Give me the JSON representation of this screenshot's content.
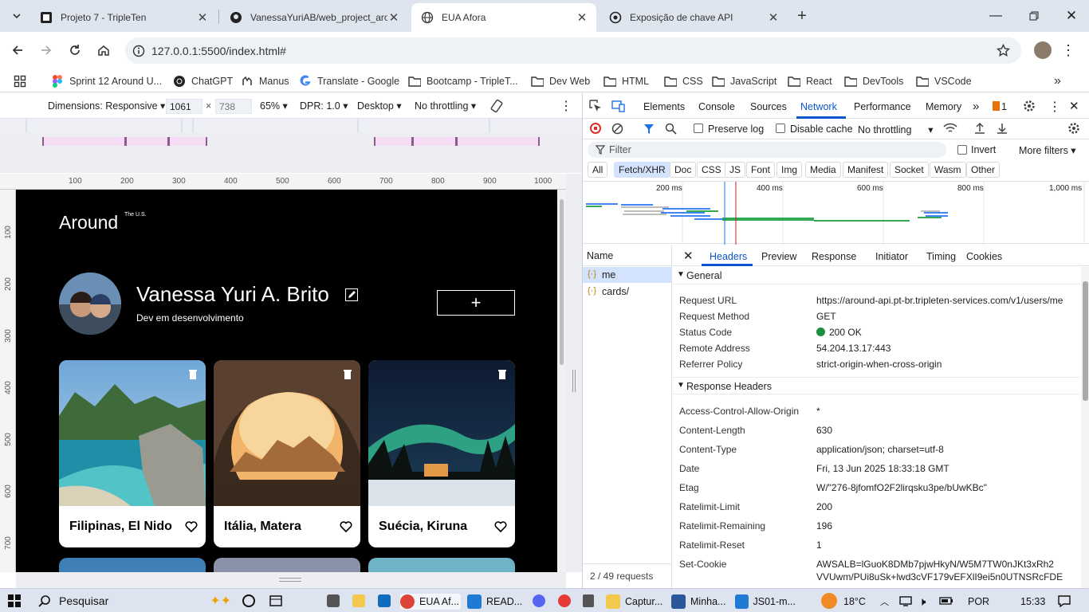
{
  "tabs": [
    {
      "title": "Projeto 7 - TripleTen",
      "icon": "tripleten-icon"
    },
    {
      "title": "VanessaYuriAB/web_project_aro",
      "icon": "github-icon"
    },
    {
      "title": "EUA Afora",
      "icon": "globe-icon",
      "active": true
    },
    {
      "title": "Exposição de chave API",
      "icon": "openai-icon"
    }
  ],
  "omnibox": {
    "url": "127.0.0.1:5500/index.html#"
  },
  "bookmarks": [
    {
      "label": "Sprint 12 Around U...",
      "icon": "figma-icon"
    },
    {
      "label": "ChatGPT",
      "icon": "openai-icon"
    },
    {
      "label": "Manus",
      "icon": "manus-icon"
    },
    {
      "label": "Translate - Google",
      "icon": "google-icon"
    },
    {
      "label": "Bootcamp - TripleT...",
      "icon": "folder-icon"
    },
    {
      "label": "Dev Web",
      "icon": "folder-icon"
    },
    {
      "label": "HTML",
      "icon": "folder-icon"
    },
    {
      "label": "CSS",
      "icon": "folder-icon"
    },
    {
      "label": "JavaScript",
      "icon": "folder-icon"
    },
    {
      "label": "React",
      "icon": "folder-icon"
    },
    {
      "label": "DevTools",
      "icon": "folder-icon"
    },
    {
      "label": "VSCode",
      "icon": "folder-icon"
    }
  ],
  "device": {
    "dimensions": "Dimensions: Responsive",
    "width": "1061",
    "x": "×",
    "height": "738",
    "zoom": "65%",
    "dpr": "DPR: 1.0",
    "mode": "Desktop",
    "throttle": "No throttling"
  },
  "ruler": {
    "top": [
      "100",
      "200",
      "300",
      "400",
      "500",
      "600",
      "700",
      "800",
      "900",
      "1000"
    ],
    "left": [
      "100",
      "200",
      "300",
      "400",
      "500",
      "600",
      "700"
    ]
  },
  "page": {
    "logo": "Around",
    "logo_sup": "The U.S.",
    "name": "Vanessa Yuri A. Brito",
    "about": "Dev em desenvolvimento",
    "add_label": "+",
    "cards": [
      {
        "title": "Filipinas, El Nido"
      },
      {
        "title": "Itália, Matera"
      },
      {
        "title": "Suécia, Kiruna"
      }
    ]
  },
  "devtools": {
    "tabs": [
      "Elements",
      "Console",
      "Sources",
      "Network",
      "Performance",
      "Memory"
    ],
    "active_tab": "Network",
    "issues_count": "1",
    "preserve_log": "Preserve log",
    "disable_cache": "Disable cache",
    "throttling": "No throttling",
    "filter_placeholder": "Filter",
    "invert": "Invert",
    "more_filters": "More filters",
    "type_filters": [
      "All",
      "Fetch/XHR",
      "Doc",
      "CSS",
      "JS",
      "Font",
      "Img",
      "Media",
      "Manifest",
      "Socket",
      "Wasm",
      "Other"
    ],
    "timeline_ticks": [
      "200 ms",
      "400 ms",
      "600 ms",
      "800 ms",
      "1,000 ms"
    ],
    "name_header": "Name",
    "requests": [
      "me",
      "cards/"
    ],
    "requests_count": "2 / 49 requests",
    "detail_tabs": [
      "Headers",
      "Preview",
      "Response",
      "Initiator",
      "Timing",
      "Cookies"
    ],
    "general_title": "General",
    "general": [
      {
        "k": "Request URL",
        "v": "https://around-api.pt-br.tripleten-services.com/v1/users/me"
      },
      {
        "k": "Request Method",
        "v": "GET"
      },
      {
        "k": "Status Code",
        "v": "200 OK"
      },
      {
        "k": "Remote Address",
        "v": "54.204.13.17:443"
      },
      {
        "k": "Referrer Policy",
        "v": "strict-origin-when-cross-origin"
      }
    ],
    "response_title": "Response Headers",
    "response": [
      {
        "k": "Access-Control-Allow-Origin",
        "v": "*"
      },
      {
        "k": "Content-Length",
        "v": "630"
      },
      {
        "k": "Content-Type",
        "v": "application/json; charset=utf-8"
      },
      {
        "k": "Date",
        "v": "Fri, 13 Jun 2025 18:33:18 GMT"
      },
      {
        "k": "Etag",
        "v": "W/\"276-8jfomfO2F2lirqsku3pe/bUwKBc\""
      },
      {
        "k": "Ratelimit-Limit",
        "v": "200"
      },
      {
        "k": "Ratelimit-Remaining",
        "v": "196"
      },
      {
        "k": "Ratelimit-Reset",
        "v": "1"
      },
      {
        "k": "Set-Cookie",
        "v": "AWSALB=lGuoK8DMb7pjwHkyN/W5M7TW0nJKt3xRh2",
        "v2": "VVUwm/PUi8uSk+lwd3cVF179vEFXlI9ei5n0UTNSRcFDE"
      }
    ]
  },
  "taskbar": {
    "search": "Pesquisar",
    "apps": [
      {
        "label": "EUA Af...",
        "icon": "chrome-icon",
        "color": "#db4437"
      },
      {
        "label": "READ...",
        "icon": "vscode-icon",
        "color": "#1f7ad4"
      },
      {
        "label": "Captur...",
        "icon": "folder-icon",
        "color": "#f2c94c"
      },
      {
        "label": "Minha...",
        "icon": "word-icon",
        "color": "#2b579a"
      },
      {
        "label": "JS01-m...",
        "icon": "vscode-icon",
        "color": "#1f7ad4"
      }
    ],
    "weather": "18°C",
    "lang": "POR",
    "time": "15:33"
  }
}
